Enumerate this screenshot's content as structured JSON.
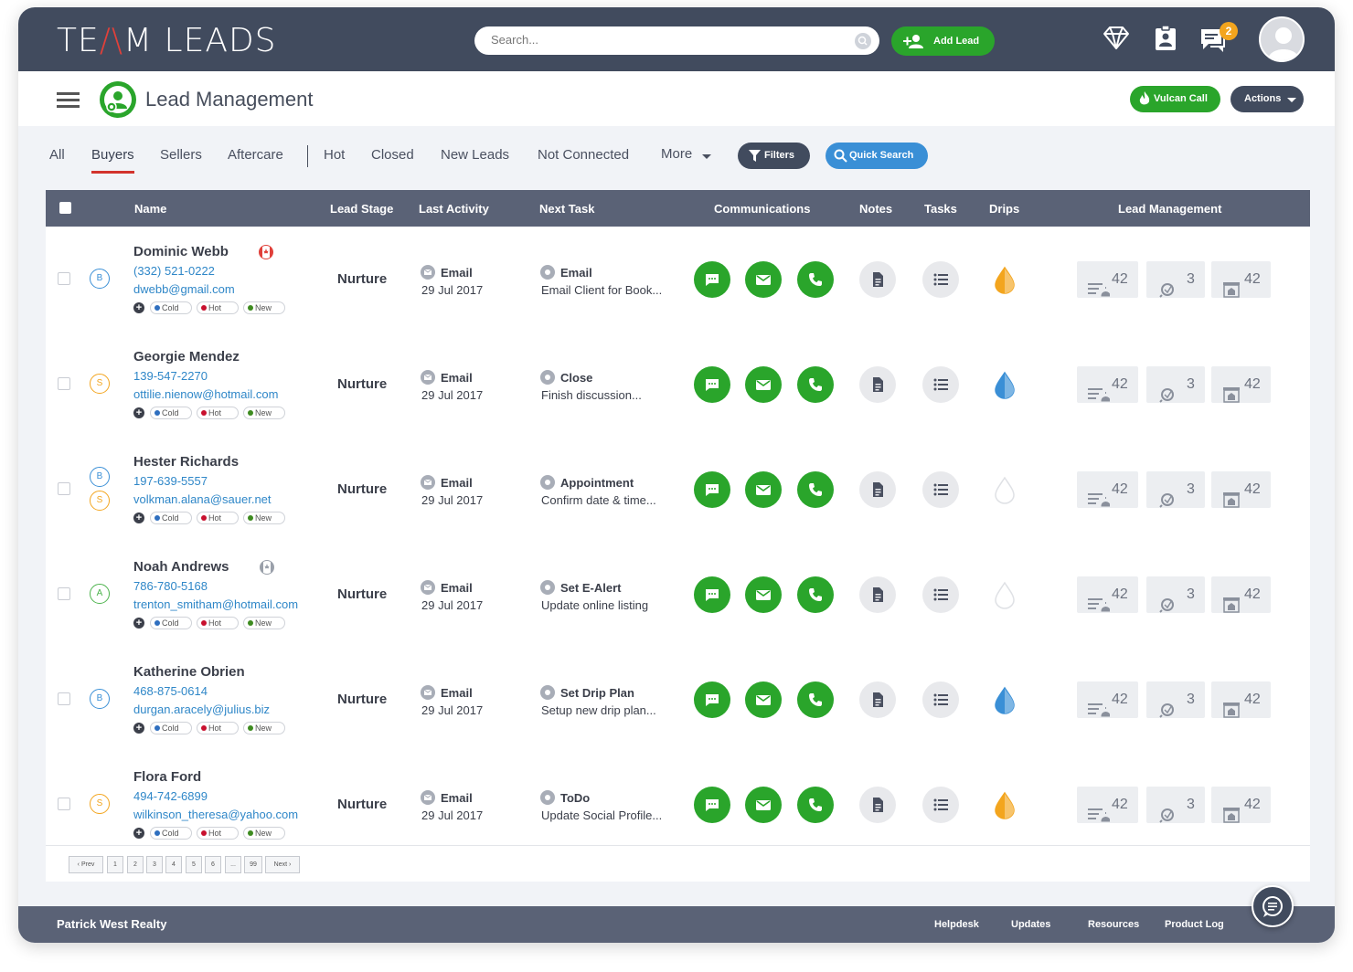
{
  "app": {
    "logo_left": "TE",
    "logo_a": "/\\",
    "logo_right": "M LEADS"
  },
  "search": {
    "placeholder": "Search..."
  },
  "topbar": {
    "add_lead": "Add Lead",
    "notification_count": "2"
  },
  "header": {
    "title": "Lead Management",
    "vulcan_call": "Vulcan Call",
    "actions": "Actions"
  },
  "tabs": {
    "all": "All",
    "buyers": "Buyers",
    "sellers": "Sellers",
    "aftercare": "Aftercare",
    "hot": "Hot",
    "closed": "Closed",
    "new_leads": "New Leads",
    "not_connected": "Not Connected",
    "more": "More",
    "filters": "Filters",
    "quick_search": "Quick Search"
  },
  "columns": {
    "name": "Name",
    "lead_stage": "Lead Stage",
    "last_activity": "Last Activity",
    "next_task": "Next Task",
    "communications": "Communications",
    "notes": "Notes",
    "tasks": "Tasks",
    "drips": "Drips",
    "lead_management": "Lead Management"
  },
  "pill_labels": {
    "cold": "Cold",
    "hot": "Hot",
    "new": "New"
  },
  "status_colors": {
    "cold": "#2f6fbf",
    "hot": "#c8102e",
    "new": "#3d8b1f",
    "green": "#2aa52b",
    "drip_orange": "#f3a51e",
    "drip_blue": "#3a8fd6"
  },
  "leads": [
    {
      "name": "Dominic Webb",
      "phone": "(332) 521-0222",
      "email": "dwebb@gmail.com",
      "tags": [
        "B"
      ],
      "flag": "canada",
      "stage": "Nurture",
      "activity_type": "Email",
      "activity_date": "29 Jul 2017",
      "task_type": "Email",
      "task_desc": "Email Client for Book...",
      "drip": "orange",
      "lm1": "42",
      "lm2": "3",
      "lm3": "42"
    },
    {
      "name": "Georgie Mendez",
      "phone": "139-547-2270",
      "email": "ottilie.nienow@hotmail.com",
      "tags": [
        "S"
      ],
      "flag": "",
      "stage": "Nurture",
      "activity_type": "Email",
      "activity_date": "29 Jul 2017",
      "task_type": "Close",
      "task_desc": "Finish discussion...",
      "drip": "blue",
      "lm1": "42",
      "lm2": "3",
      "lm3": "42"
    },
    {
      "name": "Hester Richards",
      "phone": "197-639-5557",
      "email": "volkman.alana@sauer.net",
      "tags": [
        "B",
        "S"
      ],
      "flag": "",
      "stage": "Nurture",
      "activity_type": "Email",
      "activity_date": "29 Jul 2017",
      "task_type": "Appointment",
      "task_desc": "Confirm date & time...",
      "drip": "empty",
      "lm1": "42",
      "lm2": "3",
      "lm3": "42"
    },
    {
      "name": "Noah Andrews",
      "phone": "786-780-5168",
      "email": "trenton_smitham@hotmail.com",
      "tags": [
        "A"
      ],
      "flag": "canada-gray",
      "stage": "Nurture",
      "activity_type": "Email",
      "activity_date": "29 Jul 2017",
      "task_type": "Set E-Alert",
      "task_desc": "Update online listing",
      "drip": "empty",
      "lm1": "42",
      "lm2": "3",
      "lm3": "42"
    },
    {
      "name": "Katherine Obrien",
      "phone": "468-875-0614",
      "email": "durgan.aracely@julius.biz",
      "tags": [
        "B"
      ],
      "flag": "",
      "stage": "Nurture",
      "activity_type": "Email",
      "activity_date": "29 Jul 2017",
      "task_type": "Set Drip Plan",
      "task_desc": "Setup new drip plan...",
      "drip": "blue",
      "lm1": "42",
      "lm2": "3",
      "lm3": "42"
    },
    {
      "name": "Flora Ford",
      "phone": "494-742-6899",
      "email": "wilkinson_theresa@yahoo.com",
      "tags": [
        "S"
      ],
      "flag": "",
      "stage": "Nurture",
      "activity_type": "Email",
      "activity_date": "29 Jul 2017",
      "task_type": "ToDo",
      "task_desc": "Update Social Profile...",
      "drip": "orange",
      "lm1": "42",
      "lm2": "3",
      "lm3": "42"
    }
  ],
  "pagination": {
    "prev": "Prev",
    "pages": [
      "1",
      "2",
      "3",
      "4",
      "5",
      "6",
      "...",
      "99"
    ],
    "next": "Next"
  },
  "footer": {
    "company": "Patrick West Realty",
    "links": [
      "Helpdesk",
      "Updates",
      "Resources",
      "Product Log"
    ]
  }
}
